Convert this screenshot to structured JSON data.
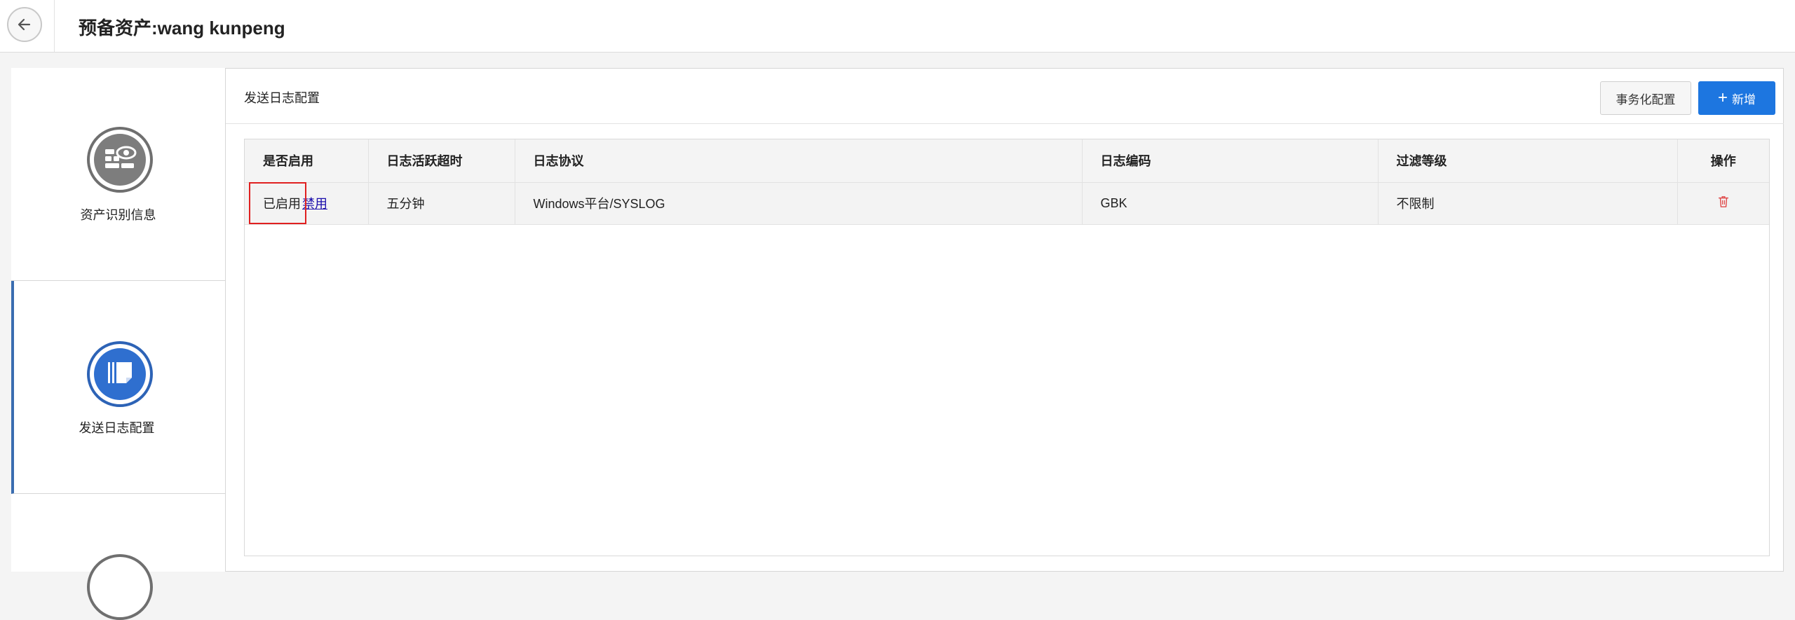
{
  "header": {
    "title": "预备资产:wang kunpeng",
    "back_icon": "arrow-left-icon"
  },
  "sidebar": {
    "items": [
      {
        "label": "资产识别信息",
        "icon": "asset-id-icon",
        "active": false
      },
      {
        "label": "发送日志配置",
        "icon": "log-send-icon",
        "active": true
      }
    ]
  },
  "panel": {
    "title": "发送日志配置",
    "transact_label": "事务化配置",
    "add_label": "新增"
  },
  "table": {
    "columns": [
      "是否启用",
      "日志活跃超时",
      "日志协议",
      "日志编码",
      "过滤等级",
      "操作"
    ],
    "rows": [
      {
        "status": "已启用",
        "toggle": "禁用",
        "timeout": "五分钟",
        "protocol": "Windows平台/SYSLOG",
        "encoding": "GBK",
        "filter": "不限制",
        "action_icon": "trash-icon"
      }
    ]
  },
  "colors": {
    "accent": "#1d76e0",
    "active_nav": "#2d63b6",
    "delete": "#e04a4a",
    "highlight": "#e02020"
  }
}
